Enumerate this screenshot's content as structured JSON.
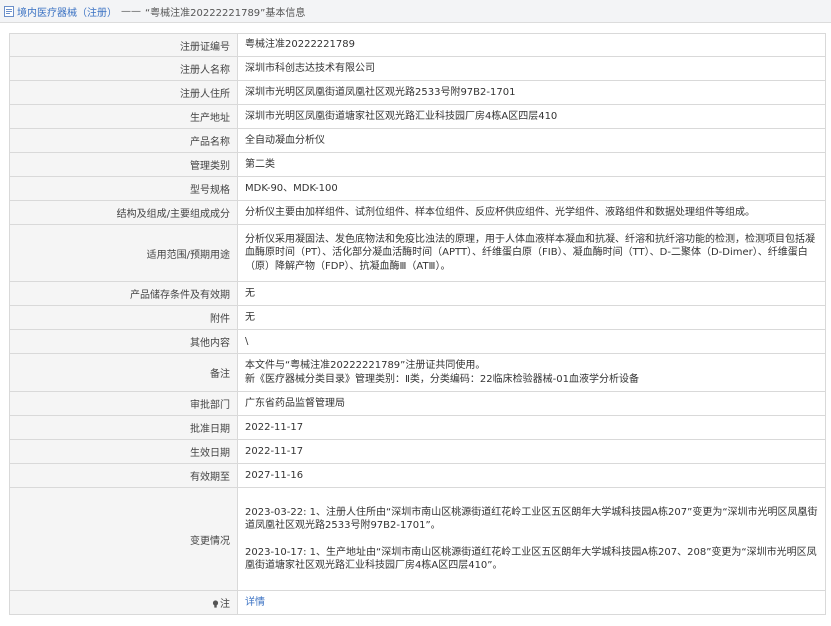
{
  "header": {
    "prefix": "境内医疗器械（注册）",
    "separator": "——",
    "suffix": "“粤械注准20222221789”基本信息"
  },
  "rows": [
    {
      "label": "注册证编号",
      "value": "粤械注准20222221789"
    },
    {
      "label": "注册人名称",
      "value": "深圳市科创志达技术有限公司"
    },
    {
      "label": "注册人住所",
      "value": "深圳市光明区凤凰街道凤凰社区观光路2533号附97B2-1701"
    },
    {
      "label": "生产地址",
      "value": "深圳市光明区凤凰街道塘家社区观光路汇业科技园厂房4栋A区四层410"
    },
    {
      "label": "产品名称",
      "value": "全自动凝血分析仪"
    },
    {
      "label": "管理类别",
      "value": "第二类"
    },
    {
      "label": "型号规格",
      "value": "MDK-90、MDK-100"
    },
    {
      "label": "结构及组成/主要组成成分",
      "value": "分析仪主要由加样组件、试剂位组件、样本位组件、反应杯供应组件、光学组件、液路组件和数据处理组件等组成。"
    },
    {
      "label": "适用范围/预期用途",
      "value": "分析仪采用凝固法、发色底物法和免疫比浊法的原理，用于人体血液样本凝血和抗凝、纤溶和抗纤溶功能的检测，检测项目包括凝血酶原时间（PT）、活化部分凝血活酶时间（APTT）、纤维蛋白原（FIB）、凝血酶时间（TT）、D-二聚体（D-Dimer）、纤维蛋白（原）降解产物（FDP）、抗凝血酶Ⅲ（ATⅢ）。"
    },
    {
      "label": "产品储存条件及有效期",
      "value": "无"
    },
    {
      "label": "附件",
      "value": "无"
    },
    {
      "label": "其他内容",
      "value": "\\"
    },
    {
      "label": "备注",
      "lines": [
        "本文件与“粤械注准20222221789”注册证共同使用。",
        "新《医疗器械分类目录》管理类别：Ⅱ类，分类编码：22临床检验器械-01血液学分析设备"
      ]
    },
    {
      "label": "审批部门",
      "value": "广东省药品监督管理局"
    },
    {
      "label": "批准日期",
      "value": "2022-11-17"
    },
    {
      "label": "生效日期",
      "value": "2022-11-17"
    },
    {
      "label": "有效期至",
      "value": "2027-11-16"
    },
    {
      "label": "变更情况",
      "lines": [
        "2023-03-22: 1、注册人住所由“深圳市南山区桃源街道红花岭工业区五区朗年大学城科技园A栋207”变更为“深圳市光明区凤凰街道凤凰社区观光路2533号附97B2-1701”。",
        "2023-10-17: 1、生产地址由“深圳市南山区桃源街道红花岭工业区五区朗年大学城科技园A栋207、208”变更为“深圳市光明区凤凰街道塘家社区观光路汇业科技园厂房4栋A区四层410”。"
      ]
    },
    {
      "label": "注",
      "value": "详情"
    }
  ]
}
